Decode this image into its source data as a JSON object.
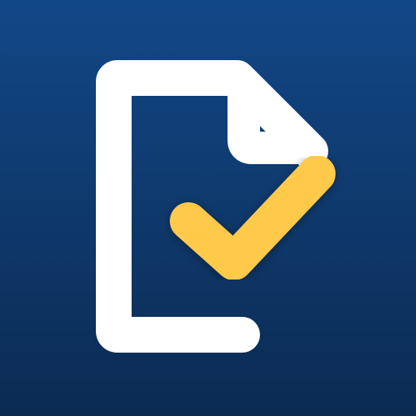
{
  "icon": {
    "name": "document-check-icon",
    "colors": {
      "background_top": "#124787",
      "background_bottom": "#0b2b52",
      "document_outline": "#ffffff",
      "checkmark": "#ffc94a",
      "shadow": "#1a1a1a"
    }
  }
}
